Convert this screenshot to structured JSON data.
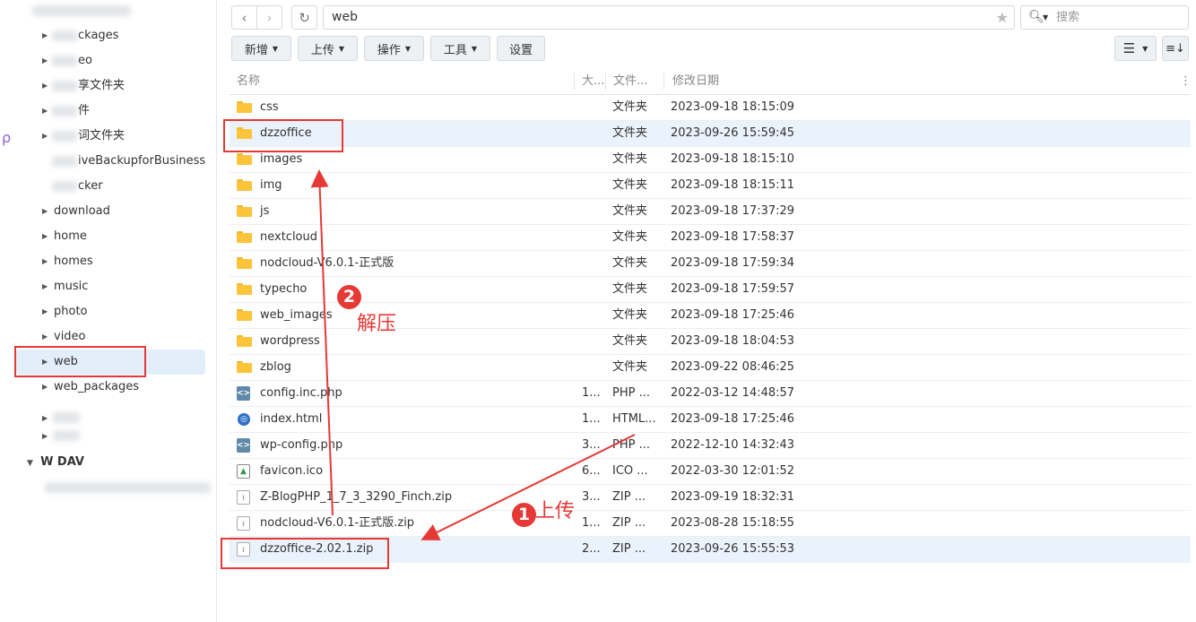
{
  "sidebar": {
    "items": [
      {
        "label": "ckages",
        "blurred": true
      },
      {
        "label": "eo",
        "blurred": true
      },
      {
        "label": "享文件夹",
        "blurred": true
      },
      {
        "label": "件",
        "blurred": true
      },
      {
        "label": "词文件夹",
        "blurred": true
      },
      {
        "label": "iveBackupforBusiness",
        "blurred": true
      },
      {
        "label": "cker",
        "blurred": true
      },
      {
        "label": "download"
      },
      {
        "label": "home"
      },
      {
        "label": "homes"
      },
      {
        "label": "music"
      },
      {
        "label": "photo"
      },
      {
        "label": "video"
      },
      {
        "label": "web",
        "selected": true
      },
      {
        "label": "web_packages"
      }
    ],
    "section_title": "W   DAV"
  },
  "toolbar": {
    "path": "web",
    "search_placeholder": "搜索",
    "buttons": [
      "新增",
      "上传",
      "操作",
      "工具",
      "设置"
    ]
  },
  "columns": {
    "name": "名称",
    "size": "大...",
    "type": "文件...",
    "modified": "修改日期"
  },
  "files": [
    {
      "name": "css",
      "size": "",
      "type": "文件夹",
      "modified": "2023-09-18 18:15:09",
      "icon": "folder-icon"
    },
    {
      "name": "dzzoffice",
      "size": "",
      "type": "文件夹",
      "modified": "2023-09-26 15:59:45",
      "icon": "folder-icon",
      "selected": true
    },
    {
      "name": "images",
      "size": "",
      "type": "文件夹",
      "modified": "2023-09-18 18:15:10",
      "icon": "folder-icon"
    },
    {
      "name": "img",
      "size": "",
      "type": "文件夹",
      "modified": "2023-09-18 18:15:11",
      "icon": "folder-icon"
    },
    {
      "name": "js",
      "size": "",
      "type": "文件夹",
      "modified": "2023-09-18 17:37:29",
      "icon": "folder-icon"
    },
    {
      "name": "nextcloud",
      "size": "",
      "type": "文件夹",
      "modified": "2023-09-18 17:58:37",
      "icon": "folder-icon"
    },
    {
      "name": "nodcloud-V6.0.1-正式版",
      "size": "",
      "type": "文件夹",
      "modified": "2023-09-18 17:59:34",
      "icon": "folder-icon"
    },
    {
      "name": "typecho",
      "size": "",
      "type": "文件夹",
      "modified": "2023-09-18 17:59:57",
      "icon": "folder-icon"
    },
    {
      "name": "web_images",
      "size": "",
      "type": "文件夹",
      "modified": "2023-09-18 17:25:46",
      "icon": "folder-icon"
    },
    {
      "name": "wordpress",
      "size": "",
      "type": "文件夹",
      "modified": "2023-09-18 18:04:53",
      "icon": "folder-icon"
    },
    {
      "name": "zblog",
      "size": "",
      "type": "文件夹",
      "modified": "2023-09-22 08:46:25",
      "icon": "folder-icon"
    },
    {
      "name": "config.inc.php",
      "size": "1...",
      "type": "PHP ...",
      "modified": "2022-03-12 14:48:57",
      "icon": "code-file-icon"
    },
    {
      "name": "index.html",
      "size": "1...",
      "type": "HTML...",
      "modified": "2023-09-18 17:25:46",
      "icon": "html-file-icon"
    },
    {
      "name": "wp-config.php",
      "size": "3...",
      "type": "PHP ...",
      "modified": "2022-12-10 14:32:43",
      "icon": "code-file-icon"
    },
    {
      "name": "favicon.ico",
      "size": "6...",
      "type": "ICO ...",
      "modified": "2022-03-30 12:01:52",
      "icon": "image-file-icon"
    },
    {
      "name": "Z-BlogPHP_1_7_3_3290_Finch.zip",
      "size": "3...",
      "type": "ZIP ...",
      "modified": "2023-09-19 18:32:31",
      "icon": "zip-file-icon"
    },
    {
      "name": "nodcloud-V6.0.1-正式版.zip",
      "size": "1...",
      "type": "ZIP ...",
      "modified": "2023-08-28 15:18:55",
      "icon": "zip-file-icon"
    },
    {
      "name": "dzzoffice-2.02.1.zip",
      "size": "2...",
      "type": "ZIP ...",
      "modified": "2023-09-26 15:55:53",
      "icon": "zip-file-icon",
      "selected": true
    }
  ],
  "annotations": {
    "step1_number": "1",
    "step1_label": "上传",
    "step2_number": "2",
    "step2_label": "解压",
    "color": "#e53935"
  }
}
